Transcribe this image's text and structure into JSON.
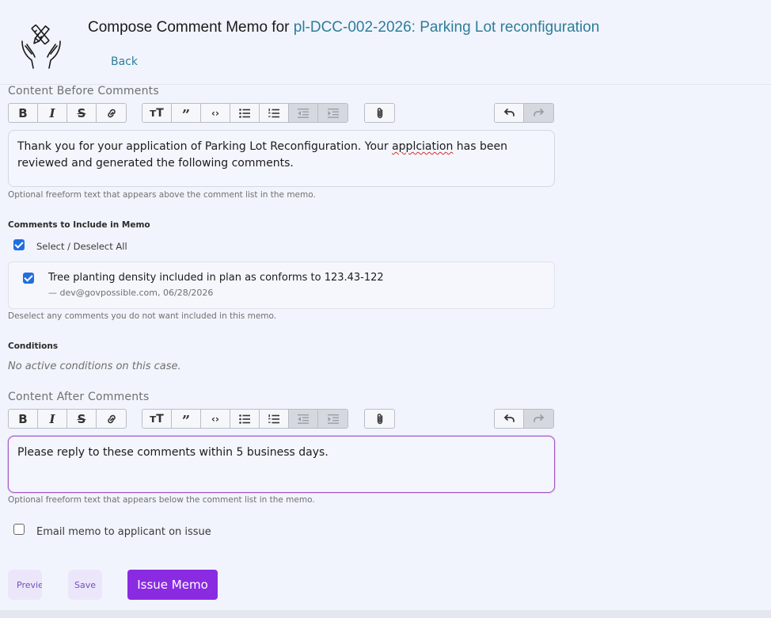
{
  "header": {
    "title_prefix": "Compose Comment Memo for ",
    "case_label": "pl-DCC-002-2026: Parking Lot reconfiguration",
    "back_label": "Back",
    "accent_color": "#2d7d9a"
  },
  "content_before": {
    "label": "Content Before Comments",
    "text_a": "Thank you for your application of Parking Lot Reconfiguration.  Your ",
    "text_misspelled": "applciation",
    "text_b": " has been reviewed and generated the following comments.",
    "help": "Optional freeform text that appears above the comment list in the memo."
  },
  "comments": {
    "heading": "Comments to Include in Memo",
    "select_all_label": "Select / Deselect All",
    "select_all_checked": true,
    "items": [
      {
        "text": "Tree planting density included in plan as conforms to 123.43-122",
        "meta": "— dev@govpossible.com, 06/28/2026",
        "checked": true
      }
    ],
    "help": "Deselect any comments you do not want included in this memo."
  },
  "conditions": {
    "heading": "Conditions",
    "empty_text": "No active conditions on this case."
  },
  "content_after": {
    "label": "Content After Comments",
    "text": "Please reply to these comments within 5 business days.",
    "help": "Optional freeform text that appears below the comment list in the memo."
  },
  "email_option": {
    "label": "Email memo to applicant on issue",
    "checked": false
  },
  "toolbar": {
    "icons": [
      "bold-icon",
      "italic-icon",
      "strikethrough-icon",
      "link-icon",
      "heading-icon",
      "quote-icon",
      "code-icon",
      "bullet-list-icon",
      "numbered-list-icon",
      "outdent-icon",
      "indent-icon",
      "attach-icon",
      "undo-icon",
      "redo-icon"
    ]
  },
  "actions": {
    "preview_label": "Preview",
    "save_label": "Save",
    "issue_label": "Issue Memo",
    "primary_color": "#8a2be2"
  }
}
